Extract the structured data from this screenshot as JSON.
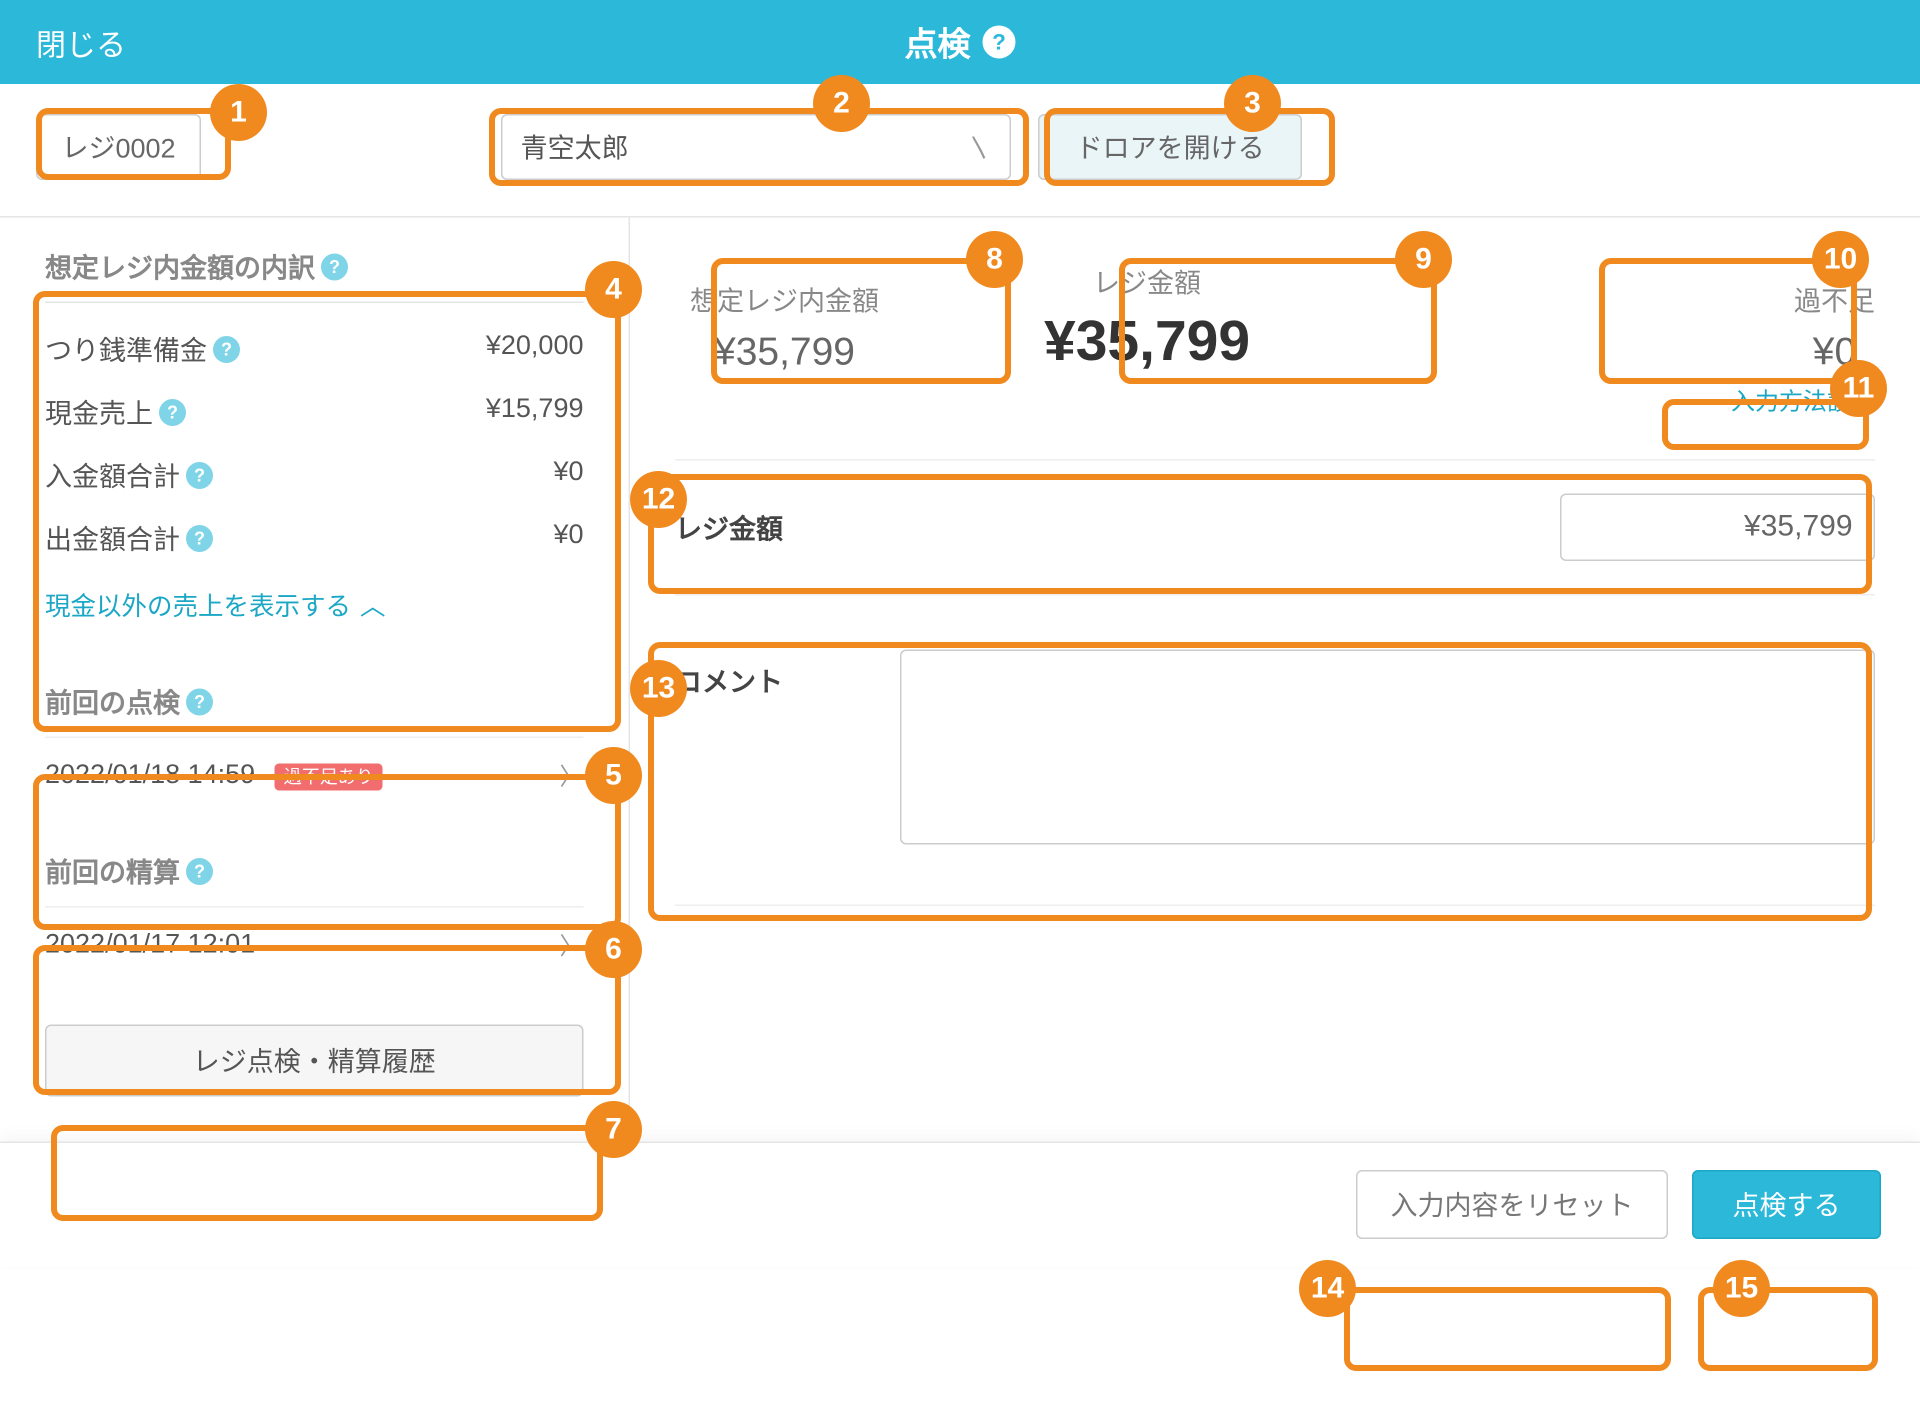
{
  "header": {
    "close": "閉じる",
    "title": "点検"
  },
  "controls": {
    "register": "レジ0002",
    "staff": "青空太郎",
    "drawer_btn": "ドロアを開ける"
  },
  "breakdown": {
    "title": "想定レジ内金額の内訳",
    "rows": [
      {
        "label": "つり銭準備金",
        "value": "¥20,000"
      },
      {
        "label": "現金売上",
        "value": "¥15,799"
      },
      {
        "label": "入金額合計",
        "value": "¥0"
      },
      {
        "label": "出金額合計",
        "value": "¥0"
      }
    ],
    "show_other": "現金以外の売上を表示する"
  },
  "last_check": {
    "title": "前回の点検",
    "datetime": "2022/01/18 14:59",
    "badge": "過不足あり"
  },
  "last_settle": {
    "title": "前回の精算",
    "datetime": "2022/01/17 12:01"
  },
  "history_btn": "レジ点検・精算履歴",
  "amounts": {
    "expected_label": "想定レジ内金額",
    "expected_value": "¥35,799",
    "actual_label": "レジ金額",
    "actual_value": "¥35,799",
    "diff_label": "過不足",
    "diff_value": "¥0"
  },
  "input_method_link": "入力方法設定",
  "actual_field": {
    "label": "レジ金額",
    "value": "¥35,799"
  },
  "comment": {
    "label": "コメント",
    "value": ""
  },
  "footer": {
    "reset": "入力内容をリセット",
    "submit": "点検する"
  },
  "annotations": [
    "1",
    "2",
    "3",
    "4",
    "5",
    "6",
    "7",
    "8",
    "9",
    "10",
    "11",
    "12",
    "13",
    "14",
    "15"
  ]
}
